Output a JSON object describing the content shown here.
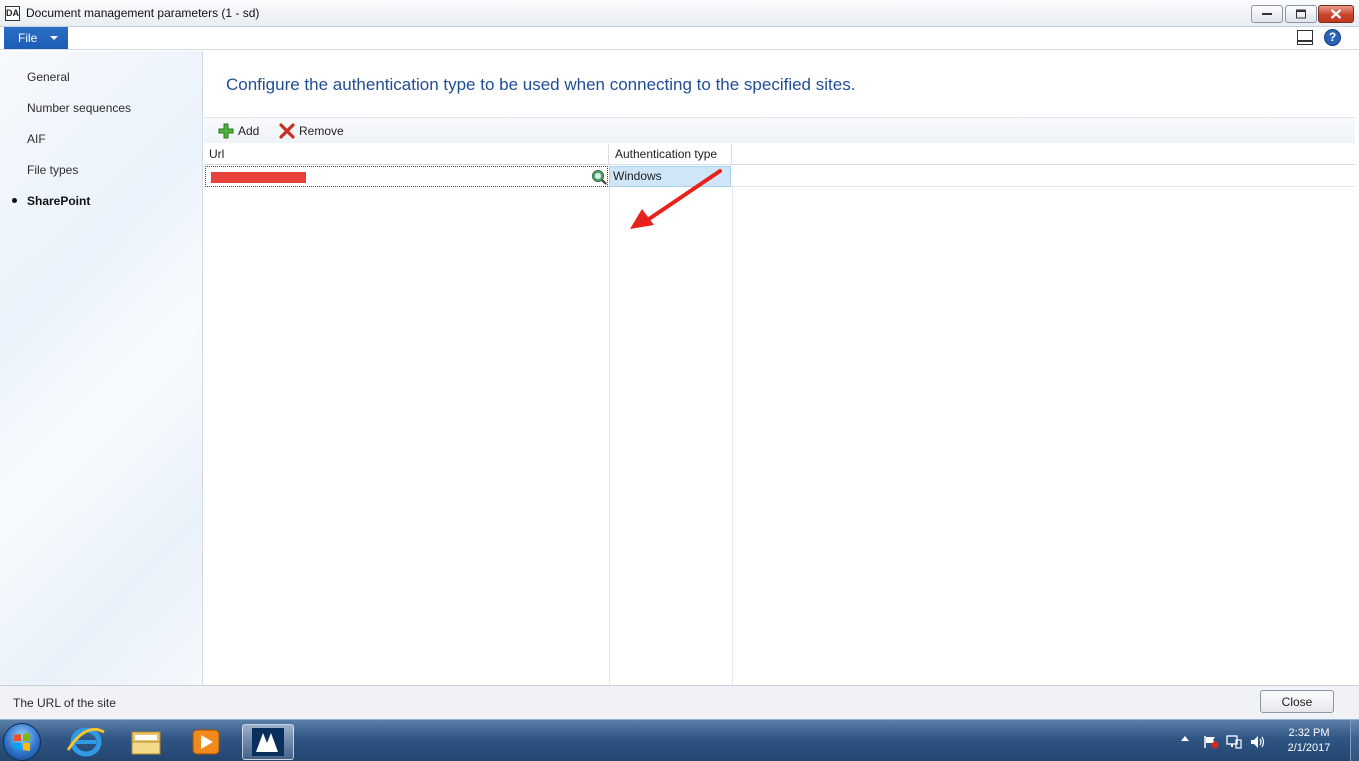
{
  "window": {
    "title": "Document management parameters (1 - sd)",
    "app_icon_text": "DA"
  },
  "menu": {
    "file_label": "File"
  },
  "nav": {
    "items": [
      {
        "label": "General"
      },
      {
        "label": "Number sequences"
      },
      {
        "label": "AIF"
      },
      {
        "label": "File types"
      },
      {
        "label": "SharePoint"
      }
    ],
    "active": "SharePoint"
  },
  "main": {
    "heading": "Configure the authentication type to be used when connecting to the specified sites.",
    "toolbar": {
      "add_label": "Add",
      "remove_label": "Remove"
    },
    "grid": {
      "columns": [
        "Url",
        "Authentication type"
      ],
      "rows": [
        {
          "url": "",
          "authentication_type": "Windows"
        }
      ]
    }
  },
  "status": {
    "text": "The URL of the site",
    "close_label": "Close"
  },
  "taskbar": {
    "time": "2:32 PM",
    "date": "2/1/2017"
  },
  "colors": {
    "heading": "#1f4e96",
    "file_button": "#1d5db5",
    "selected_cell": "#cfe6f8",
    "annotation_arrow": "#e8211a",
    "redaction": "#e8413a"
  }
}
